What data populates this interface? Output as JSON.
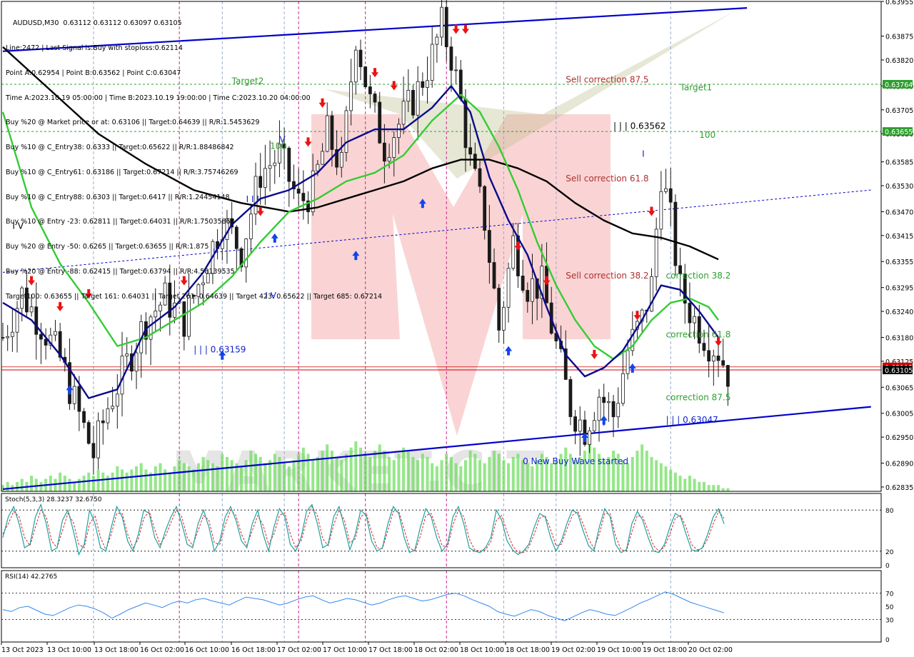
{
  "header": {
    "symbol": "AUDUSD,M30  0.63112 0.63112 0.63097 0.63105",
    "lines": [
      "Line:2472 | Last Signal is:Buy with stoploss:0.62114",
      "Point A:0.62954 | Point B:0.63562 | Point C:0.63047",
      "Time A:2023.10.19 05:00:00 | Time B:2023.10.19 19:00:00 | Time C:2023.10.20 04:00:00",
      "Buy %20 @ Market price or at: 0.63106 || Target:0.64639 || R/R:1.5453629",
      "Buy %10 @ C_Entry38: 0.6333 || Target:0.65622 || R/R:1.88486842",
      "Buy %10 @ C_Entry61: 0.63186 || Target:0.67214 || R/R:3.75746269",
      "Buy %10 @ C_Entry88: 0.6303 || Target:0.6417 || R/R:1.24454148",
      "Buy %10 @ Entry -23: 0.62811 || Target:0.64031 || R/R:1.75035868",
      "Buy %20 @ Entry -50: 0.6265 || Target:0.63655 || R/R:1.875",
      "Buy %20 @ Entry -88: 0.62415 || Target:0.63794 || R/R:4.58139535",
      "Target100: 0.63655 || Target 161: 0.64031 || Target 261: 0.64639 || Target 423: 0.65622 || Target 685: 0.67214"
    ]
  },
  "colors": {
    "background": "#ffffff",
    "price_line": "#cc0000",
    "channel": "#0000cc",
    "ma_fast": "#0a0a8c",
    "ma_mid": "#33cc33",
    "ma_slow": "#000000",
    "candle": "#1a1a1a",
    "volume": "#66dd55",
    "target_green": "#2e9e2e",
    "sell_red": "#b03030",
    "stoch_main": "#20a0a0",
    "stoch_signal": "#dd2222",
    "rsi_line": "#3388ee",
    "current_price_bg": "#cc0000",
    "target1_bg": "#2e9e2e"
  },
  "chart_data": {
    "type": "candlestick",
    "symbol": "AUDUSD",
    "timeframe": "M30",
    "ylim": [
      0.62825,
      0.63955
    ],
    "price_axis_ticks": [
      "0.63955",
      "0.63875",
      "0.63820",
      "0.63760",
      "0.63705",
      "0.63650",
      "0.63585",
      "0.63530",
      "0.63470",
      "0.63415",
      "0.63355",
      "0.63295",
      "0.63240",
      "0.63180",
      "0.63125",
      "0.63065",
      "0.63005",
      "0.62950",
      "0.62890",
      "0.62835"
    ],
    "price_labels": {
      "current": "0.63105",
      "line2": "0.63112",
      "target1": "0.63764",
      "target100": "0.63655"
    },
    "x_labels": [
      "13 Oct 2023",
      "13 Oct 10:00",
      "13 Oct 18:00",
      "16 Oct 02:00",
      "16 Oct 10:00",
      "16 Oct 18:00",
      "17 Oct 02:00",
      "17 Oct 10:00",
      "17 Oct 18:00",
      "18 Oct 02:00",
      "18 Oct 10:00",
      "18 Oct 18:00",
      "19 Oct 02:00",
      "19 Oct 10:00",
      "19 Oct 18:00",
      "20 Oct 02:00"
    ],
    "close_path": [
      [
        0,
        0.6318
      ],
      [
        4,
        0.6328
      ],
      [
        8,
        0.6321
      ],
      [
        12,
        0.6313
      ],
      [
        16,
        0.63
      ],
      [
        19,
        0.6291
      ],
      [
        22,
        0.6302
      ],
      [
        26,
        0.6312
      ],
      [
        30,
        0.6322
      ],
      [
        34,
        0.6327
      ],
      [
        38,
        0.6322
      ],
      [
        42,
        0.6333
      ],
      [
        46,
        0.6345
      ],
      [
        50,
        0.6338
      ],
      [
        54,
        0.6356
      ],
      [
        58,
        0.636
      ],
      [
        62,
        0.6349
      ],
      [
        65,
        0.6352
      ],
      [
        68,
        0.6365
      ],
      [
        71,
        0.6357
      ],
      [
        74,
        0.6388
      ],
      [
        77,
        0.6372
      ],
      [
        80,
        0.6362
      ],
      [
        84,
        0.6369
      ],
      [
        87,
        0.6375
      ],
      [
        90,
        0.6383
      ],
      [
        92,
        0.639
      ],
      [
        94,
        0.6383
      ],
      [
        96,
        0.6372
      ],
      [
        98,
        0.6358
      ],
      [
        101,
        0.6345
      ],
      [
        104,
        0.632
      ],
      [
        107,
        0.634
      ],
      [
        110,
        0.633
      ],
      [
        113,
        0.633
      ],
      [
        116,
        0.6316
      ],
      [
        119,
        0.6302
      ],
      [
        122,
        0.6297
      ],
      [
        125,
        0.6305
      ],
      [
        128,
        0.63
      ],
      [
        131,
        0.6315
      ],
      [
        134,
        0.6322
      ],
      [
        136,
        0.633
      ],
      [
        138,
        0.6356
      ],
      [
        140,
        0.6345
      ],
      [
        142,
        0.6329
      ],
      [
        145,
        0.6322
      ],
      [
        148,
        0.6317
      ],
      [
        150,
        0.6315
      ],
      [
        152,
        0.631
      ]
    ],
    "volume": [
      2,
      3,
      2,
      3,
      4,
      3,
      5,
      4,
      3,
      4,
      5,
      4,
      6,
      5,
      4,
      3,
      4,
      5,
      6,
      5,
      7,
      6,
      5,
      6,
      8,
      7,
      6,
      7,
      8,
      9,
      7,
      6,
      8,
      9,
      7,
      6,
      8,
      10,
      9,
      8,
      7,
      9,
      11,
      10,
      9,
      8,
      12,
      11,
      10,
      9,
      8,
      10,
      13,
      12,
      11,
      9,
      10,
      12,
      11,
      9,
      8,
      10,
      12,
      14,
      12,
      10,
      11,
      13,
      15,
      13,
      11,
      10,
      12,
      14,
      16,
      14,
      12,
      11,
      13,
      15,
      13,
      11,
      10,
      12,
      14,
      13,
      11,
      10,
      12,
      11,
      9,
      8,
      10,
      12,
      11,
      9,
      8,
      10,
      13,
      12,
      10,
      9,
      11,
      13,
      12,
      10,
      9,
      11,
      12,
      10,
      9,
      8,
      10,
      12,
      11,
      9,
      10,
      12,
      14,
      12,
      10,
      11,
      13,
      15,
      14,
      12,
      10,
      11,
      13,
      12,
      10,
      9,
      11,
      13,
      15,
      13,
      11,
      10,
      9,
      8,
      7,
      6,
      5,
      4,
      5,
      4,
      3,
      3,
      2,
      2,
      2,
      1,
      1
    ],
    "ma_fast": [
      [
        0,
        0.6326
      ],
      [
        6,
        0.6322
      ],
      [
        12,
        0.6314
      ],
      [
        18,
        0.6304
      ],
      [
        24,
        0.6306
      ],
      [
        30,
        0.632
      ],
      [
        36,
        0.6325
      ],
      [
        42,
        0.6333
      ],
      [
        48,
        0.6344
      ],
      [
        54,
        0.635
      ],
      [
        60,
        0.6352
      ],
      [
        66,
        0.6356
      ],
      [
        72,
        0.6363
      ],
      [
        78,
        0.6366
      ],
      [
        84,
        0.6366
      ],
      [
        90,
        0.6371
      ],
      [
        94,
        0.6376
      ],
      [
        98,
        0.637
      ],
      [
        102,
        0.6355
      ],
      [
        106,
        0.6345
      ],
      [
        110,
        0.6337
      ],
      [
        114,
        0.6325
      ],
      [
        118,
        0.6314
      ],
      [
        122,
        0.6309
      ],
      [
        126,
        0.6311
      ],
      [
        130,
        0.6315
      ],
      [
        134,
        0.6322
      ],
      [
        138,
        0.633
      ],
      [
        142,
        0.6329
      ],
      [
        146,
        0.6324
      ],
      [
        150,
        0.6318
      ]
    ],
    "ma_mid": [
      [
        0,
        0.637
      ],
      [
        6,
        0.6348
      ],
      [
        12,
        0.6335
      ],
      [
        18,
        0.6326
      ],
      [
        24,
        0.6316
      ],
      [
        30,
        0.6318
      ],
      [
        36,
        0.6322
      ],
      [
        42,
        0.6326
      ],
      [
        48,
        0.6332
      ],
      [
        54,
        0.634
      ],
      [
        60,
        0.6347
      ],
      [
        66,
        0.635
      ],
      [
        72,
        0.6354
      ],
      [
        78,
        0.6356
      ],
      [
        84,
        0.636
      ],
      [
        90,
        0.6368
      ],
      [
        96,
        0.6374
      ],
      [
        100,
        0.637
      ],
      [
        104,
        0.6362
      ],
      [
        108,
        0.6352
      ],
      [
        112,
        0.634
      ],
      [
        116,
        0.633
      ],
      [
        120,
        0.6322
      ],
      [
        124,
        0.6316
      ],
      [
        128,
        0.6313
      ],
      [
        132,
        0.6316
      ],
      [
        136,
        0.6322
      ],
      [
        140,
        0.6326
      ],
      [
        144,
        0.6327
      ],
      [
        148,
        0.6325
      ],
      [
        150,
        0.6322
      ]
    ],
    "ma_slow": [
      [
        0,
        0.6385
      ],
      [
        10,
        0.6375
      ],
      [
        20,
        0.6365
      ],
      [
        30,
        0.6358
      ],
      [
        40,
        0.6352
      ],
      [
        50,
        0.6349
      ],
      [
        60,
        0.6347
      ],
      [
        66,
        0.6348
      ],
      [
        72,
        0.635
      ],
      [
        78,
        0.6352
      ],
      [
        84,
        0.6354
      ],
      [
        90,
        0.6357
      ],
      [
        96,
        0.6359
      ],
      [
        102,
        0.6359
      ],
      [
        108,
        0.6357
      ],
      [
        114,
        0.6354
      ],
      [
        120,
        0.6349
      ],
      [
        126,
        0.6345
      ],
      [
        132,
        0.6342
      ],
      [
        138,
        0.6341
      ],
      [
        144,
        0.6339
      ],
      [
        150,
        0.6336
      ]
    ],
    "channel_upper": [
      [
        0,
        0.6384
      ],
      [
        156,
        0.6394
      ]
    ],
    "channel_lower": [
      [
        0,
        0.6283
      ],
      [
        182,
        0.6302
      ]
    ],
    "channel_mid": [
      [
        0,
        0.6333
      ],
      [
        182,
        0.6352
      ]
    ],
    "levels": {
      "current_price": 0.63105,
      "price_line2": 0.63112,
      "target1": 0.63764,
      "target100": 0.63655
    },
    "annotations": [
      {
        "text": "Target2",
        "color": "green",
        "x": 48,
        "price": 0.63765
      },
      {
        "text": "Target1",
        "color": "green",
        "x": 142,
        "price": 0.6375
      },
      {
        "text": "100",
        "color": "green",
        "x": 56,
        "price": 0.63615
      },
      {
        "text": "100",
        "color": "green",
        "x": 146,
        "price": 0.6364
      },
      {
        "text": "Sell correction 87.5",
        "color": "red",
        "x": 118,
        "price": 0.63768
      },
      {
        "text": "Sell correction 61.8",
        "color": "red",
        "x": 118,
        "price": 0.6354
      },
      {
        "text": "Sell correction 38.2",
        "color": "red",
        "x": 118,
        "price": 0.63316
      },
      {
        "text": "correction 38.2",
        "color": "green",
        "x": 139,
        "price": 0.63316
      },
      {
        "text": "correction 61.8",
        "color": "green",
        "x": 139,
        "price": 0.6318
      },
      {
        "text": "correction 87.5",
        "color": "green",
        "x": 139,
        "price": 0.63035
      },
      {
        "text": "| | | 0.63562",
        "color": "black",
        "x": 128,
        "price": 0.63661
      },
      {
        "text": "| | | 0.63159",
        "color": "blue",
        "x": 40,
        "price": 0.63145
      },
      {
        "text": "| | | 0.63047",
        "color": "blue",
        "x": 139,
        "price": 0.62983
      },
      {
        "text": "0 New Buy Wave started",
        "color": "blue",
        "x": 109,
        "price": 0.62888
      },
      {
        "text": "I V",
        "color": "black",
        "x": 2,
        "price": 0.6343
      },
      {
        "text": "I I I",
        "color": "blue",
        "x": 51,
        "price": 0.63492
      },
      {
        "text": "I",
        "color": "blue",
        "x": 44,
        "price": 0.6337
      },
      {
        "text": "I V",
        "color": "blue",
        "x": 55,
        "price": 0.6327
      },
      {
        "text": "V",
        "color": "blue",
        "x": 58,
        "price": 0.6363
      },
      {
        "text": "I",
        "color": "blue",
        "x": 134,
        "price": 0.63597
      }
    ],
    "arrows_up": [
      [
        14,
        0.6307
      ],
      [
        46,
        0.6315
      ],
      [
        57,
        0.6342
      ],
      [
        74,
        0.6338
      ],
      [
        106,
        0.6316
      ],
      [
        122,
        0.6296
      ],
      [
        126,
        0.63
      ],
      [
        132,
        0.6312
      ],
      [
        88,
        0.635
      ]
    ],
    "arrows_down": [
      [
        6,
        0.633
      ],
      [
        12,
        0.6324
      ],
      [
        18,
        0.6327
      ],
      [
        38,
        0.633
      ],
      [
        54,
        0.6346
      ],
      [
        64,
        0.6362
      ],
      [
        67,
        0.6371
      ],
      [
        78,
        0.6378
      ],
      [
        82,
        0.6375
      ],
      [
        95,
        0.6388
      ],
      [
        97,
        0.6388
      ],
      [
        108,
        0.6338
      ],
      [
        114,
        0.633
      ],
      [
        124,
        0.6313
      ],
      [
        133,
        0.6322
      ],
      [
        136,
        0.6346
      ],
      [
        150,
        0.6316
      ]
    ],
    "vertical_lines": [
      {
        "x": 37,
        "style": "magenta"
      },
      {
        "x": 62,
        "style": "magenta"
      },
      {
        "x": 76,
        "style": "magenta"
      },
      {
        "x": 93,
        "style": "magenta"
      },
      {
        "x": 19,
        "style": "grey"
      },
      {
        "x": 46,
        "style": "grey"
      },
      {
        "x": 59,
        "style": "grey"
      },
      {
        "x": 105,
        "style": "grey"
      },
      {
        "x": 116,
        "style": "grey"
      },
      {
        "x": 140,
        "style": "grey"
      }
    ],
    "stoch": {
      "label": "Stoch(5,3,3) 28.3237 32.6750",
      "ylim": [
        0,
        100
      ],
      "levels": [
        80,
        20
      ],
      "ticks": [
        "80",
        "20",
        "0"
      ],
      "main": [
        40,
        70,
        85,
        60,
        25,
        30,
        70,
        88,
        60,
        20,
        25,
        65,
        80,
        50,
        15,
        30,
        80,
        60,
        25,
        20,
        55,
        85,
        70,
        35,
        20,
        45,
        80,
        75,
        40,
        25,
        50,
        70,
        85,
        60,
        30,
        25,
        60,
        80,
        55,
        20,
        35,
        70,
        85,
        65,
        35,
        25,
        60,
        80,
        45,
        20,
        55,
        82,
        70,
        30,
        20,
        40,
        78,
        88,
        60,
        25,
        30,
        70,
        85,
        55,
        22,
        45,
        80,
        72,
        35,
        20,
        25,
        60,
        85,
        75,
        40,
        18,
        22,
        55,
        82,
        70,
        40,
        20,
        30,
        70,
        85,
        60,
        25,
        20,
        18,
        25,
        40,
        80,
        65,
        35,
        22,
        15,
        20,
        30,
        55,
        75,
        70,
        40,
        20,
        35,
        60,
        80,
        75,
        50,
        28,
        20,
        55,
        82,
        70,
        30,
        18,
        22,
        60,
        78,
        65,
        40,
        20,
        18,
        30,
        55,
        75,
        70,
        45,
        22,
        20,
        25,
        45,
        70,
        82,
        60
      ],
      "signal": [
        45,
        60,
        78,
        70,
        40,
        28,
        55,
        80,
        70,
        35,
        25,
        50,
        75,
        62,
        30,
        25,
        60,
        72,
        40,
        22,
        45,
        75,
        75,
        45,
        25,
        38,
        68,
        78,
        52,
        30,
        42,
        62,
        80,
        70,
        40,
        28,
        50,
        72,
        65,
        32,
        30,
        58,
        80,
        72,
        45,
        28,
        50,
        72,
        58,
        30,
        45,
        72,
        76,
        45,
        25,
        35,
        65,
        85,
        72,
        38,
        28,
        58,
        80,
        65,
        32,
        38,
        70,
        76,
        48,
        25,
        24,
        50,
        78,
        78,
        52,
        25,
        20,
        42,
        72,
        75,
        52,
        28,
        26,
        58,
        80,
        70,
        38,
        22,
        20,
        22,
        34,
        65,
        72,
        48,
        28,
        18,
        18,
        26,
        45,
        68,
        72,
        52,
        28,
        30,
        52,
        72,
        78,
        60,
        38,
        24,
        45,
        75,
        75,
        42,
        22,
        20,
        48,
        72,
        70,
        50,
        28,
        20,
        26,
        45,
        68,
        72,
        55,
        30,
        22,
        24,
        38,
        60,
        78,
        68
      ]
    },
    "rsi": {
      "label": "RSI(14) 42.2765",
      "ylim": [
        0,
        100
      ],
      "levels": [
        70,
        30
      ],
      "ticks": [
        "70",
        "50",
        "30",
        "0"
      ],
      "values": [
        45,
        42,
        48,
        50,
        44,
        38,
        36,
        42,
        48,
        52,
        50,
        46,
        40,
        32,
        38,
        45,
        50,
        55,
        52,
        48,
        54,
        58,
        55,
        60,
        62,
        58,
        55,
        52,
        58,
        64,
        62,
        60,
        56,
        52,
        55,
        60,
        64,
        66,
        60,
        55,
        58,
        62,
        60,
        56,
        52,
        55,
        60,
        64,
        66,
        62,
        58,
        60,
        64,
        68,
        70,
        66,
        60,
        55,
        50,
        42,
        38,
        35,
        40,
        45,
        42,
        36,
        32,
        28,
        34,
        40,
        45,
        42,
        38,
        36,
        42,
        48,
        55,
        60,
        66,
        72,
        68,
        62,
        56,
        52,
        48,
        44,
        40
      ]
    }
  },
  "watermark": {
    "text": "MARKET.CIT",
    "colors": [
      "#f4a0a0",
      "#b9b98a"
    ]
  }
}
